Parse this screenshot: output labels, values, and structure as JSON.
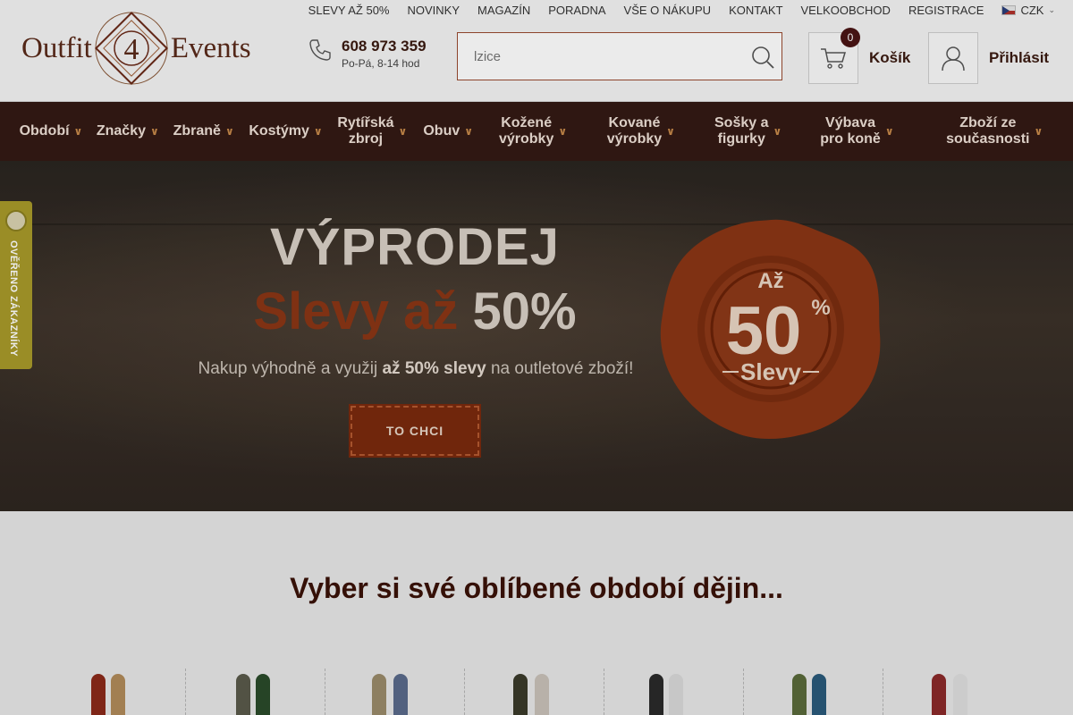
{
  "top_links": [
    "SLEVY AŽ 50%",
    "NOVINKY",
    "MAGAZÍN",
    "PORADNA",
    "VŠE O NÁKUPU",
    "KONTAKT",
    "VELKOOBCHOD",
    "REGISTRACE"
  ],
  "currency": "CZK",
  "logo": {
    "word1": "Outfit",
    "emblem": "4",
    "word2": "Events"
  },
  "phone": {
    "number": "608 973 359",
    "hours": "Po-Pá, 8-14 hod"
  },
  "search": {
    "placeholder": "lzice"
  },
  "cart": {
    "count": "0",
    "label": "Košík"
  },
  "login": {
    "label": "Přihlásit"
  },
  "nav": [
    {
      "label": "Období",
      "width": 86
    },
    {
      "label": "Značky",
      "width": 86
    },
    {
      "label": "Zbraně",
      "width": 84
    },
    {
      "label": "Kostýmy",
      "width": 100
    },
    {
      "label": "Rytířská\nzbroj",
      "width": 94
    },
    {
      "label": "Obuv",
      "width": 76
    },
    {
      "label": "Kožené\nvýrobky",
      "width": 114
    },
    {
      "label": "Kované\nvýrobky",
      "width": 128
    },
    {
      "label": "Sošky a\nfigurky",
      "width": 112
    },
    {
      "label": "Výbava\npro koně",
      "width": 132
    },
    {
      "label": "Zboží ze\nsoučasnosti",
      "width": 176
    }
  ],
  "hero": {
    "title": "VÝPRODEJ",
    "sub_a": "Slevy až",
    "sub_b": "50%",
    "text_pre": "Nakup výhodně a využij ",
    "text_bold": "až 50% slevy",
    "text_post": " na outletové zboží!",
    "button": "TO CHCI",
    "seal_top": "Až",
    "seal_num": "50",
    "seal_pct": "%",
    "seal_bottom": "Slevy"
  },
  "side_badge": "OVĚŘENO ZÁKAZNÍKY",
  "section_title": "Vyber si své oblíbené období dějin...",
  "colors": {
    "brand": "#331914",
    "accent": "#7a2a0e",
    "seal": "#8a3615"
  }
}
